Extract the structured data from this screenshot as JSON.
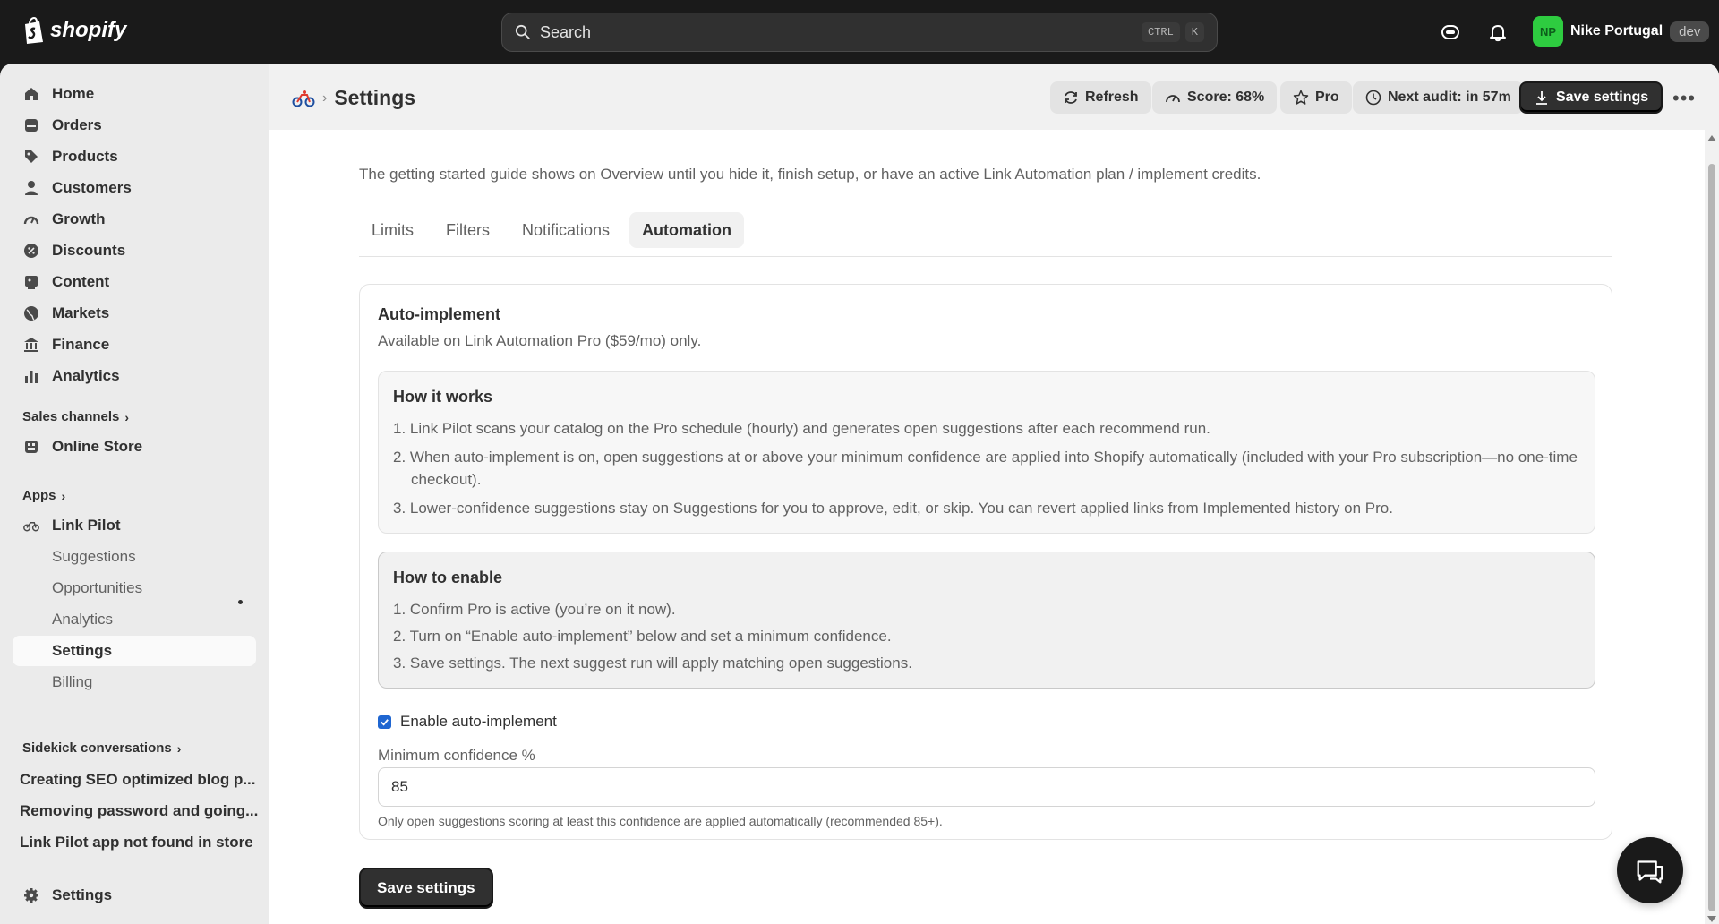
{
  "topbar": {
    "logo_text": "shopify",
    "search_placeholder": "Search",
    "search_kbd1": "CTRL",
    "search_kbd2": "K",
    "user_initials": "NP",
    "user_name": "Nike Portugal",
    "user_badge": "dev"
  },
  "sidebar": {
    "items": [
      {
        "label": "Home",
        "icon": "home-icon"
      },
      {
        "label": "Orders",
        "icon": "orders-icon"
      },
      {
        "label": "Products",
        "icon": "tag-icon"
      },
      {
        "label": "Customers",
        "icon": "person-icon"
      },
      {
        "label": "Growth",
        "icon": "gauge-icon"
      },
      {
        "label": "Discounts",
        "icon": "discount-icon"
      },
      {
        "label": "Content",
        "icon": "content-icon"
      },
      {
        "label": "Markets",
        "icon": "globe-icon"
      },
      {
        "label": "Finance",
        "icon": "bank-icon"
      },
      {
        "label": "Analytics",
        "icon": "bar-chart-icon"
      }
    ],
    "sales_channels_title": "Sales channels",
    "online_store": "Online Store",
    "apps_title": "Apps",
    "app_name": "Link Pilot",
    "app_subitems": [
      "Suggestions",
      "Opportunities",
      "Analytics",
      "Settings",
      "Billing"
    ],
    "sidekick_title": "Sidekick conversations",
    "conversations": [
      "Creating SEO optimized blog p...",
      "Removing password and going...",
      "Link Pilot app not found in store"
    ],
    "settings_label": "Settings"
  },
  "header": {
    "title": "Settings",
    "refresh": "Refresh",
    "score": "Score: 68%",
    "pro": "Pro",
    "next_audit": "Next audit: in 57m",
    "save": "Save settings"
  },
  "main": {
    "intro": "The getting started guide shows on Overview until you hide it, finish setup, or have an active Link Automation plan / implement credits.",
    "tabs": [
      "Limits",
      "Filters",
      "Notifications",
      "Automation"
    ],
    "active_tab": "Automation",
    "card": {
      "title": "Auto-implement",
      "subtitle": "Available on Link Automation Pro ($59/mo) only.",
      "how_works_title": "How it works",
      "how_works": [
        "1. Link Pilot scans your catalog on the Pro schedule (hourly) and generates open suggestions after each recommend run.",
        "2. When auto-implement is on, open suggestions at or above your minimum confidence are applied into Shopify automatically (included with your Pro subscription—no one-time checkout).",
        "3. Lower-confidence suggestions stay on Suggestions for you to approve, edit, or skip. You can revert applied links from Implemented history on Pro."
      ],
      "how_enable_title": "How to enable",
      "how_enable": [
        "1. Confirm Pro is active (you’re on it now).",
        "2. Turn on “Enable auto-implement” below and set a minimum confidence.",
        "3. Save settings. The next suggest run will apply matching open suggestions."
      ],
      "checkbox_label": "Enable auto-implement",
      "checkbox_checked": true,
      "min_conf_label": "Minimum confidence %",
      "min_conf_value": "85",
      "help": "Only open suggestions scoring at least this confidence are applied automatically (recommended 85+)."
    },
    "save_button": "Save settings"
  }
}
